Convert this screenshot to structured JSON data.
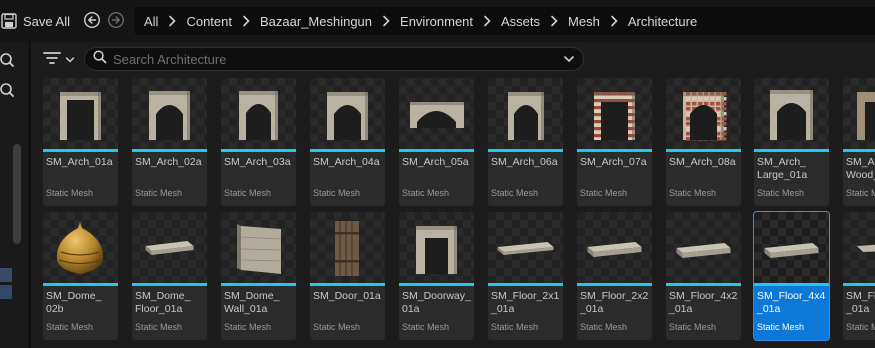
{
  "toolbar": {
    "save_all_label": "Save All",
    "back_icon": "back-arrow-icon",
    "forward_icon": "forward-arrow-icon"
  },
  "breadcrumb": [
    "All",
    "Content",
    "Bazaar_Meshingun",
    "Environment",
    "Assets",
    "Mesh",
    "Architecture"
  ],
  "search": {
    "placeholder": "Search Architecture",
    "value": ""
  },
  "assets": [
    {
      "name": "SM_Arch_01a",
      "type": "Static Mesh",
      "thumb": "arch-a"
    },
    {
      "name": "SM_Arch_02a",
      "type": "Static Mesh",
      "thumb": "arch-b"
    },
    {
      "name": "SM_Arch_03a",
      "type": "Static Mesh",
      "thumb": "arch-c"
    },
    {
      "name": "SM_Arch_04a",
      "type": "Static Mesh",
      "thumb": "arch-d"
    },
    {
      "name": "SM_Arch_05a",
      "type": "Static Mesh",
      "thumb": "arch-bridge"
    },
    {
      "name": "SM_Arch_06a",
      "type": "Static Mesh",
      "thumb": "arch-e"
    },
    {
      "name": "SM_Arch_07a",
      "type": "Static Mesh",
      "thumb": "arch-striped"
    },
    {
      "name": "SM_Arch_08a",
      "type": "Static Mesh",
      "thumb": "arch-brick"
    },
    {
      "name": "SM_Arch_\nLarge_01a",
      "type": "Static Mesh",
      "thumb": "arch-large"
    },
    {
      "name": "SM_A\nWood_",
      "type": "Static Mesh",
      "thumb": "arch-wood"
    },
    {
      "name": "SM_Dome_\n02b",
      "type": "Static Mesh",
      "thumb": "dome"
    },
    {
      "name": "SM_Dome_\nFloor_01a",
      "type": "Static Mesh",
      "thumb": "slab"
    },
    {
      "name": "SM_Dome_\nWall_01a",
      "type": "Static Mesh",
      "thumb": "wall"
    },
    {
      "name": "SM_Door_01a",
      "type": "Static Mesh",
      "thumb": "door"
    },
    {
      "name": "SM_Doorway_\n01a",
      "type": "Static Mesh",
      "thumb": "doorway"
    },
    {
      "name": "SM_Floor_2x1\n_01a",
      "type": "Static Mesh",
      "thumb": "floor-thin"
    },
    {
      "name": "SM_Floor_2x2\n_01a",
      "type": "Static Mesh",
      "thumb": "floor-2x2"
    },
    {
      "name": "SM_Floor_4x2\n_01a",
      "type": "Static Mesh",
      "thumb": "floor-4x2"
    },
    {
      "name": "SM_Floor_4x4\n_01a",
      "type": "Static Mesh",
      "thumb": "floor-4x4",
      "selected": true
    },
    {
      "name": "SM_Fl\n_01a",
      "type": "Static Mesh",
      "thumb": "floor-partial"
    }
  ],
  "colors": {
    "selection": "#0c78d8",
    "asset_type_bar": "#1ec8f0"
  }
}
